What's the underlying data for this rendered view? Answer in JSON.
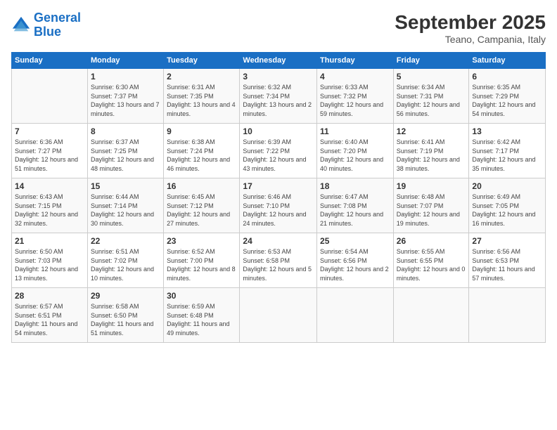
{
  "logo": {
    "line1": "General",
    "line2": "Blue"
  },
  "header": {
    "month": "September 2025",
    "location": "Teano, Campania, Italy"
  },
  "weekdays": [
    "Sunday",
    "Monday",
    "Tuesday",
    "Wednesday",
    "Thursday",
    "Friday",
    "Saturday"
  ],
  "weeks": [
    [
      {
        "day": "",
        "sunrise": "",
        "sunset": "",
        "daylight": ""
      },
      {
        "day": "1",
        "sunrise": "Sunrise: 6:30 AM",
        "sunset": "Sunset: 7:37 PM",
        "daylight": "Daylight: 13 hours and 7 minutes."
      },
      {
        "day": "2",
        "sunrise": "Sunrise: 6:31 AM",
        "sunset": "Sunset: 7:35 PM",
        "daylight": "Daylight: 13 hours and 4 minutes."
      },
      {
        "day": "3",
        "sunrise": "Sunrise: 6:32 AM",
        "sunset": "Sunset: 7:34 PM",
        "daylight": "Daylight: 13 hours and 2 minutes."
      },
      {
        "day": "4",
        "sunrise": "Sunrise: 6:33 AM",
        "sunset": "Sunset: 7:32 PM",
        "daylight": "Daylight: 12 hours and 59 minutes."
      },
      {
        "day": "5",
        "sunrise": "Sunrise: 6:34 AM",
        "sunset": "Sunset: 7:31 PM",
        "daylight": "Daylight: 12 hours and 56 minutes."
      },
      {
        "day": "6",
        "sunrise": "Sunrise: 6:35 AM",
        "sunset": "Sunset: 7:29 PM",
        "daylight": "Daylight: 12 hours and 54 minutes."
      }
    ],
    [
      {
        "day": "7",
        "sunrise": "Sunrise: 6:36 AM",
        "sunset": "Sunset: 7:27 PM",
        "daylight": "Daylight: 12 hours and 51 minutes."
      },
      {
        "day": "8",
        "sunrise": "Sunrise: 6:37 AM",
        "sunset": "Sunset: 7:25 PM",
        "daylight": "Daylight: 12 hours and 48 minutes."
      },
      {
        "day": "9",
        "sunrise": "Sunrise: 6:38 AM",
        "sunset": "Sunset: 7:24 PM",
        "daylight": "Daylight: 12 hours and 46 minutes."
      },
      {
        "day": "10",
        "sunrise": "Sunrise: 6:39 AM",
        "sunset": "Sunset: 7:22 PM",
        "daylight": "Daylight: 12 hours and 43 minutes."
      },
      {
        "day": "11",
        "sunrise": "Sunrise: 6:40 AM",
        "sunset": "Sunset: 7:20 PM",
        "daylight": "Daylight: 12 hours and 40 minutes."
      },
      {
        "day": "12",
        "sunrise": "Sunrise: 6:41 AM",
        "sunset": "Sunset: 7:19 PM",
        "daylight": "Daylight: 12 hours and 38 minutes."
      },
      {
        "day": "13",
        "sunrise": "Sunrise: 6:42 AM",
        "sunset": "Sunset: 7:17 PM",
        "daylight": "Daylight: 12 hours and 35 minutes."
      }
    ],
    [
      {
        "day": "14",
        "sunrise": "Sunrise: 6:43 AM",
        "sunset": "Sunset: 7:15 PM",
        "daylight": "Daylight: 12 hours and 32 minutes."
      },
      {
        "day": "15",
        "sunrise": "Sunrise: 6:44 AM",
        "sunset": "Sunset: 7:14 PM",
        "daylight": "Daylight: 12 hours and 30 minutes."
      },
      {
        "day": "16",
        "sunrise": "Sunrise: 6:45 AM",
        "sunset": "Sunset: 7:12 PM",
        "daylight": "Daylight: 12 hours and 27 minutes."
      },
      {
        "day": "17",
        "sunrise": "Sunrise: 6:46 AM",
        "sunset": "Sunset: 7:10 PM",
        "daylight": "Daylight: 12 hours and 24 minutes."
      },
      {
        "day": "18",
        "sunrise": "Sunrise: 6:47 AM",
        "sunset": "Sunset: 7:08 PM",
        "daylight": "Daylight: 12 hours and 21 minutes."
      },
      {
        "day": "19",
        "sunrise": "Sunrise: 6:48 AM",
        "sunset": "Sunset: 7:07 PM",
        "daylight": "Daylight: 12 hours and 19 minutes."
      },
      {
        "day": "20",
        "sunrise": "Sunrise: 6:49 AM",
        "sunset": "Sunset: 7:05 PM",
        "daylight": "Daylight: 12 hours and 16 minutes."
      }
    ],
    [
      {
        "day": "21",
        "sunrise": "Sunrise: 6:50 AM",
        "sunset": "Sunset: 7:03 PM",
        "daylight": "Daylight: 12 hours and 13 minutes."
      },
      {
        "day": "22",
        "sunrise": "Sunrise: 6:51 AM",
        "sunset": "Sunset: 7:02 PM",
        "daylight": "Daylight: 12 hours and 10 minutes."
      },
      {
        "day": "23",
        "sunrise": "Sunrise: 6:52 AM",
        "sunset": "Sunset: 7:00 PM",
        "daylight": "Daylight: 12 hours and 8 minutes."
      },
      {
        "day": "24",
        "sunrise": "Sunrise: 6:53 AM",
        "sunset": "Sunset: 6:58 PM",
        "daylight": "Daylight: 12 hours and 5 minutes."
      },
      {
        "day": "25",
        "sunrise": "Sunrise: 6:54 AM",
        "sunset": "Sunset: 6:56 PM",
        "daylight": "Daylight: 12 hours and 2 minutes."
      },
      {
        "day": "26",
        "sunrise": "Sunrise: 6:55 AM",
        "sunset": "Sunset: 6:55 PM",
        "daylight": "Daylight: 12 hours and 0 minutes."
      },
      {
        "day": "27",
        "sunrise": "Sunrise: 6:56 AM",
        "sunset": "Sunset: 6:53 PM",
        "daylight": "Daylight: 11 hours and 57 minutes."
      }
    ],
    [
      {
        "day": "28",
        "sunrise": "Sunrise: 6:57 AM",
        "sunset": "Sunset: 6:51 PM",
        "daylight": "Daylight: 11 hours and 54 minutes."
      },
      {
        "day": "29",
        "sunrise": "Sunrise: 6:58 AM",
        "sunset": "Sunset: 6:50 PM",
        "daylight": "Daylight: 11 hours and 51 minutes."
      },
      {
        "day": "30",
        "sunrise": "Sunrise: 6:59 AM",
        "sunset": "Sunset: 6:48 PM",
        "daylight": "Daylight: 11 hours and 49 minutes."
      },
      {
        "day": "",
        "sunrise": "",
        "sunset": "",
        "daylight": ""
      },
      {
        "day": "",
        "sunrise": "",
        "sunset": "",
        "daylight": ""
      },
      {
        "day": "",
        "sunrise": "",
        "sunset": "",
        "daylight": ""
      },
      {
        "day": "",
        "sunrise": "",
        "sunset": "",
        "daylight": ""
      }
    ]
  ]
}
